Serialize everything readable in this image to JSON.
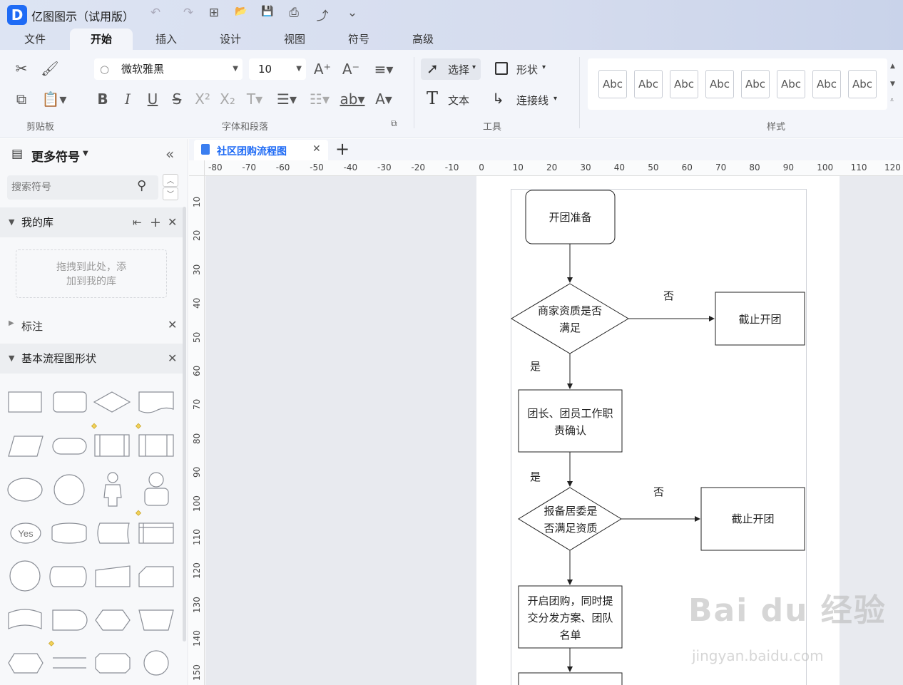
{
  "app": {
    "title": "亿图图示（试用版）",
    "logo_letter": "D"
  },
  "quick": {
    "undo": "↶",
    "redo": "↷",
    "new": "⊞",
    "open": "📂",
    "save": "💾",
    "print": "⎙",
    "export": "⤴",
    "more": "⌄"
  },
  "tabs": [
    "文件",
    "开始",
    "插入",
    "设计",
    "视图",
    "符号",
    "高级"
  ],
  "ribbon": {
    "font_name": "微软雅黑",
    "font_size": "10",
    "group_clipboard": "剪贴板",
    "group_font": "字体和段落",
    "group_tools": "工具",
    "group_style": "样式",
    "select_label": "选择",
    "shape_label": "形状",
    "text_label": "文本",
    "connector_label": "连接线",
    "style_samples": [
      "Abc",
      "Abc",
      "Abc",
      "Abc",
      "Abc",
      "Abc",
      "Abc",
      "Abc"
    ]
  },
  "left": {
    "title": "更多符号",
    "search_placeholder": "搜索符号",
    "my_lib": "我的库",
    "drop_hint_1": "拖拽到此处，添",
    "drop_hint_2": "加到我的库",
    "annotation": "标注",
    "basic": "基本流程图形状",
    "yes_shape": "Yes"
  },
  "doc_tab": "社区团购流程图",
  "ruler_h": [
    "-80",
    "-70",
    "-60",
    "-50",
    "-40",
    "-30",
    "-20",
    "-10",
    "0",
    "10",
    "20",
    "30",
    "40",
    "50",
    "60",
    "70",
    "80",
    "90",
    "100",
    "110",
    "120"
  ],
  "ruler_v": [
    "10",
    "20",
    "30",
    "40",
    "50",
    "60",
    "70",
    "80",
    "90",
    "100",
    "110",
    "120",
    "130",
    "140",
    "150"
  ],
  "flow": {
    "start": "开团准备",
    "d1_l1": "商家资质是否",
    "d1_l2": "满足",
    "no1": "否",
    "end1": "截止开团",
    "yes1": "是",
    "p1_l1": "团长、团员工作职",
    "p1_l2": "责确认",
    "yes2": "是",
    "d2_l1": "报备居委是",
    "d2_l2": "否满足资质",
    "no2": "否",
    "end2": "截止开团",
    "p2_l1": "开启团购，同时提",
    "p2_l2": "交分发方案、团队",
    "p2_l3": "名单"
  },
  "watermark": {
    "main": "Bai du 经验",
    "sub": "jingyan.baidu.com"
  }
}
